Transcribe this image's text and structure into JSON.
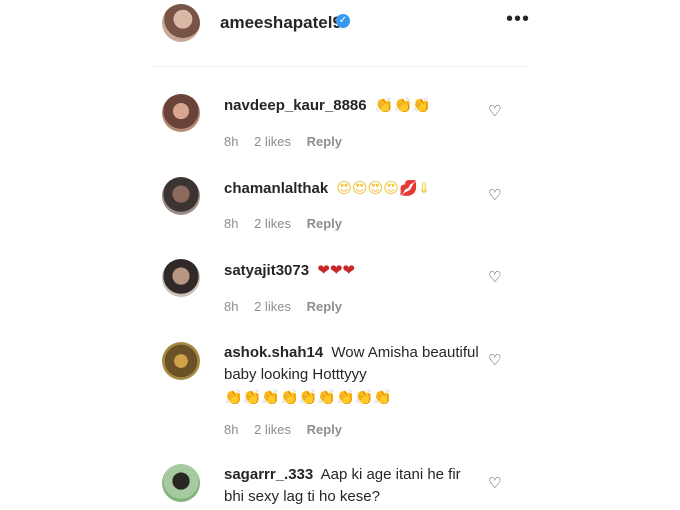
{
  "post_author": {
    "username": "ameeshapatel9",
    "verified_icon": "verified-badge-icon",
    "more_label": "•••"
  },
  "comments": [
    {
      "user": "navdeep_kaur_8886",
      "text": "",
      "emoji": "👏👏👏",
      "emoji_color": "yellow",
      "time": "8h",
      "likes": "2 likes",
      "reply": "Reply",
      "heart": "♡"
    },
    {
      "user": "chamanlalthak",
      "text": "",
      "emoji": "😍😍😍😍💋⇓",
      "emoji_color": "yellow",
      "time": "8h",
      "likes": "2 likes",
      "reply": "Reply",
      "heart": "♡"
    },
    {
      "user": "satyajit3073",
      "text": "",
      "emoji": "❤❤❤",
      "emoji_color": "red",
      "time": "8h",
      "likes": "2 likes",
      "reply": "Reply",
      "heart": "♡"
    },
    {
      "user": "ashok.shah14",
      "text": "Wow Amisha beautiful baby looking Hotttyyy",
      "emoji": "👏👏👏👏👏👏👏👏👏",
      "emoji_color": "yellow",
      "time": "8h",
      "likes": "2 likes",
      "reply": "Reply",
      "heart": "♡"
    },
    {
      "user": "sagarrr_.333",
      "text": "Aap ki age itani he fir bhi sexy lag ti ho kese?",
      "emoji": "",
      "emoji_color": "yellow",
      "time": "",
      "likes": "",
      "reply": "",
      "heart": "♡"
    }
  ]
}
